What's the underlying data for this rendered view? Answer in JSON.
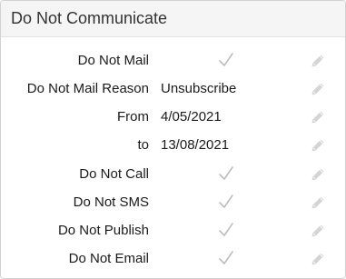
{
  "panel": {
    "title": "Do Not Communicate"
  },
  "rows": [
    {
      "label": "Do Not Mail",
      "type": "check",
      "checked": true
    },
    {
      "label": "Do Not Mail Reason",
      "type": "text",
      "value": "Unsubscribe"
    },
    {
      "label": "From",
      "type": "text",
      "value": "4/05/2021"
    },
    {
      "label": "to",
      "type": "text",
      "value": "13/08/2021"
    },
    {
      "label": "Do Not Call",
      "type": "check",
      "checked": true
    },
    {
      "label": "Do Not SMS",
      "type": "check",
      "checked": true
    },
    {
      "label": "Do Not Publish",
      "type": "check",
      "checked": true
    },
    {
      "label": "Do Not Email",
      "type": "check",
      "checked": true
    }
  ],
  "icons": {
    "check": "check-icon",
    "edit": "pencil-icon"
  },
  "colors": {
    "header_bg": "#f5f5f5",
    "border": "#d2d2d2",
    "check_color": "#bdbdbd",
    "pencil_color": "#cfcfcf"
  }
}
